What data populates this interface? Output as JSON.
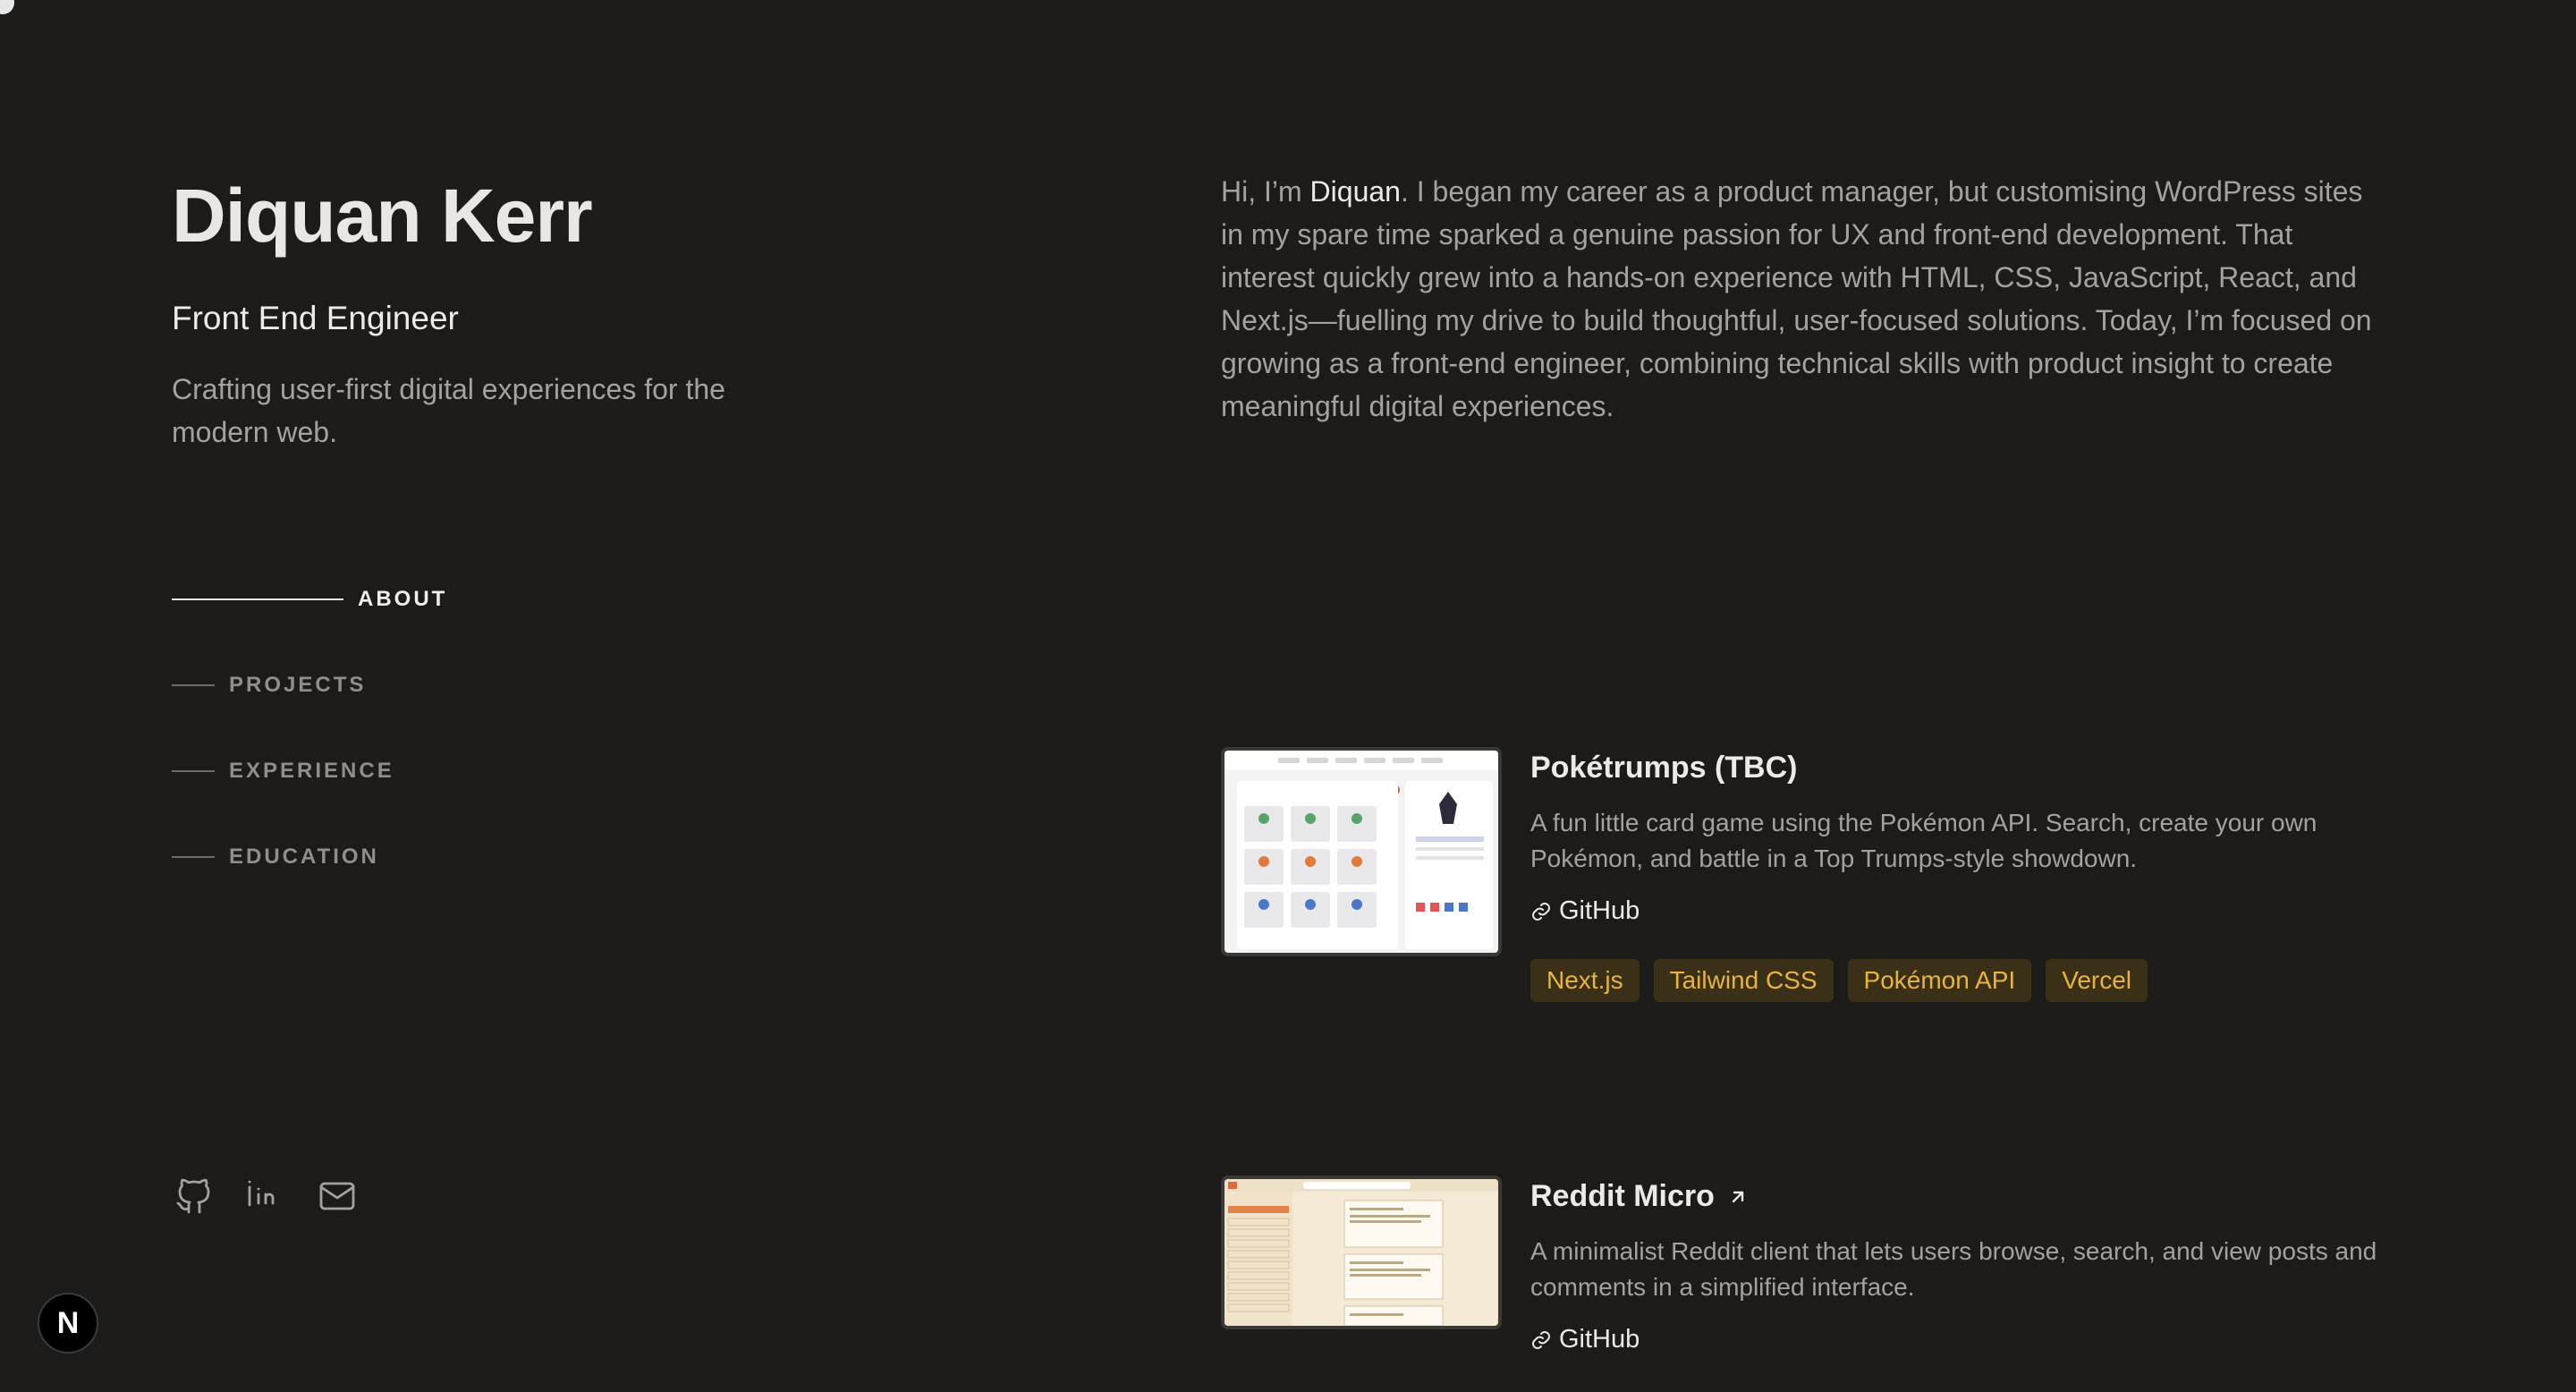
{
  "profile": {
    "name": "Diquan Kerr",
    "role": "Front End Engineer",
    "tagline": "Crafting user-first digital experiences for the modern web."
  },
  "nav": {
    "items": [
      {
        "label": "ABOUT",
        "active": true
      },
      {
        "label": "PROJECTS",
        "active": false
      },
      {
        "label": "EXPERIENCE",
        "active": false
      },
      {
        "label": "EDUCATION",
        "active": false
      }
    ]
  },
  "socials": [
    "github-icon",
    "linkedin-icon",
    "mail-icon"
  ],
  "next_badge": "N",
  "about": {
    "intro": "Hi, I’m ",
    "highlight": "Diquan",
    "body": ". I began my career as a product manager, but customising WordPress sites in my spare time sparked a genuine passion for UX and front-end development. That interest quickly grew into a hands-on experience with HTML, CSS, JavaScript, React, and Next.js—fuelling my drive to build thoughtful, user-focused solutions. Today, I’m focused on growing as a front-end engineer, combining technical skills with product insight to create meaningful digital experiences."
  },
  "projects": [
    {
      "title": "Pokétrumps (TBC)",
      "description": "A fun little card game using the Pokémon API. Search, create your own Pokémon, and battle in a Top Trumps-style showdown.",
      "link_label": "GitHub",
      "tags": [
        "Next.js",
        "Tailwind CSS",
        "Pokémon API",
        "Vercel"
      ]
    },
    {
      "title": "Reddit Micro",
      "description": "A minimalist Reddit client that lets users browse, search, and view posts and comments in a simplified interface.",
      "link_label": "GitHub"
    }
  ],
  "colors": {
    "background": "#1c1b1a",
    "text_primary": "#eceae6",
    "text_muted": "#a3a2a0",
    "tag_bg": "#3a2f17",
    "tag_text": "#e8b43d"
  }
}
